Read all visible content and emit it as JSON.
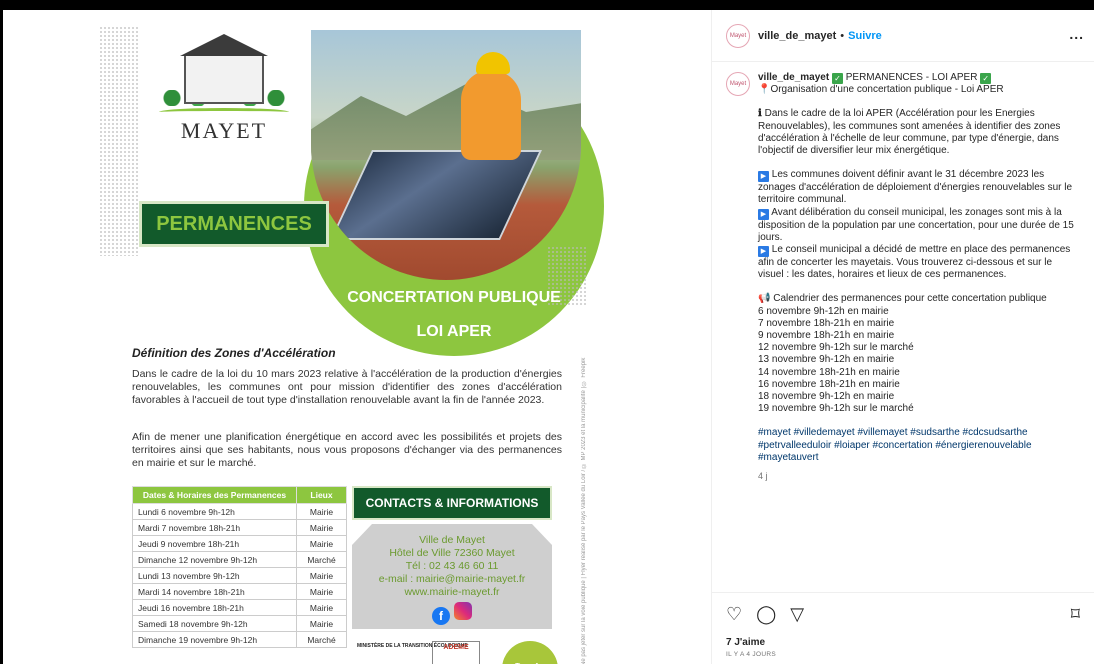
{
  "flyer": {
    "logo_name": "MAYET",
    "permanences": "PERMANENCES",
    "concertation": "CONCERTATION PUBLIQUE",
    "loi_aper": "LOI APER",
    "heading": "Définition des Zones d'Accélération",
    "para1": "Dans le cadre de la loi du 10 mars 2023 relative à l'accélération de la production d'énergies renouvelables, les communes ont pour mission d'identifier des zones d'accélération favorables à l'accueil de tout type d'installation renouvelable avant la fin de l'année 2023.",
    "para2": "Afin de mener une planification énergétique en accord avec les possibilités et projets des territoires ainsi que ses habitants, nous vous proposons d'échanger via des permanences en mairie et sur le marché.",
    "vertical_text": "Ne pas jeter sur la voie publique | Flyer réalisé par le Pays Vallée du Loir / © MP 2023 et la municipalité | © Freepik",
    "table": {
      "col1": "Dates & Horaires des Permanences",
      "col2": "Lieux",
      "rows": [
        {
          "date": "Lundi 6 novembre 9h-12h",
          "lieu": "Mairie"
        },
        {
          "date": "Mardi 7 novembre 18h-21h",
          "lieu": "Mairie"
        },
        {
          "date": "Jeudi 9 novembre 18h-21h",
          "lieu": "Mairie"
        },
        {
          "date": "Dimanche 12 novembre 9h-12h",
          "lieu": "Marché"
        },
        {
          "date": "Lundi 13 novembre 9h-12h",
          "lieu": "Mairie"
        },
        {
          "date": "Mardi 14 novembre 18h-21h",
          "lieu": "Mairie"
        },
        {
          "date": "Jeudi 16 novembre 18h-21h",
          "lieu": "Mairie"
        },
        {
          "date": "Samedi 18 novembre 9h-12h",
          "lieu": "Mairie"
        },
        {
          "date": "Dimanche 19 novembre 9h-12h",
          "lieu": "Marché"
        }
      ]
    },
    "contacts": {
      "header": "CONTACTS & INFORMATIONS",
      "lines": [
        "Ville de Mayet",
        "Hôtel de Ville 72360 Mayet",
        "Tél : 02 43 46 60 11",
        "e-mail : mairie@mairie-mayet.fr",
        "www.mairie-mayet.fr"
      ]
    },
    "partners": {
      "ministere": "MINISTÈRE DE LA TRANSITION ÉCOLOGIQUE",
      "ademe": "ADEME",
      "loir": "Loir"
    }
  },
  "post": {
    "username": "ville_de_mayet",
    "separator": "•",
    "follow": "Suivre",
    "more": "...",
    "avatar_text": "Mayet",
    "caption": {
      "title": "PERMANENCES - LOI APER",
      "line2": "Organisation d'une concertation publique - Loi APER",
      "info_icon": "ℹ",
      "p1": "Dans le cadre de la loi APER (Accélération pour les Energies Renouvelables), les communes sont amenées à identifier des zones d'accélération à l'échelle de leur commune, par type d'énergie, dans l'objectif de diversifier leur mix énergétique.",
      "b1": "Les communes doivent définir avant le 31 décembre 2023 les zonages d'accélération de déploiement d'énergies renouvelables sur le territoire communal.",
      "b2": "Avant délibération du conseil municipal, les zonages sont mis à la disposition de la population par une concertation, pour une durée de 15 jours.",
      "b3": "Le conseil municipal a décidé de mettre en place des permanences afin de concerter les mayetais. Vous trouverez ci-dessous et sur le visuel : les dates, horaires et lieux de ces permanences.",
      "cal_title": "Calendrier des permanences pour cette concertation publique",
      "dates": [
        "6 novembre 9h-12h en mairie",
        "7 novembre 18h-21h en mairie",
        "9 novembre 18h-21h en mairie",
        "12 novembre 9h-12h sur le marché",
        "13 novembre 9h-12h en mairie",
        "14 novembre 18h-21h en mairie",
        "16 novembre 18h-21h en mairie",
        "18 novembre 9h-12h en mairie",
        "19 novembre 9h-12h sur le marché"
      ],
      "hashtags": "#mayet #villedemayet #villemayet #sudsarthe #cdcsudsarthe #petrvalleeduloir #loiaper #concertation #énergierenouvelable #mayetauvert",
      "ago": "4 j"
    },
    "likes": "7 J'aime",
    "date": "IL Y A 4 JOURS"
  },
  "icons": {
    "heart": "♡",
    "comment": "◯",
    "share": "▽",
    "bookmark": "⌑"
  }
}
